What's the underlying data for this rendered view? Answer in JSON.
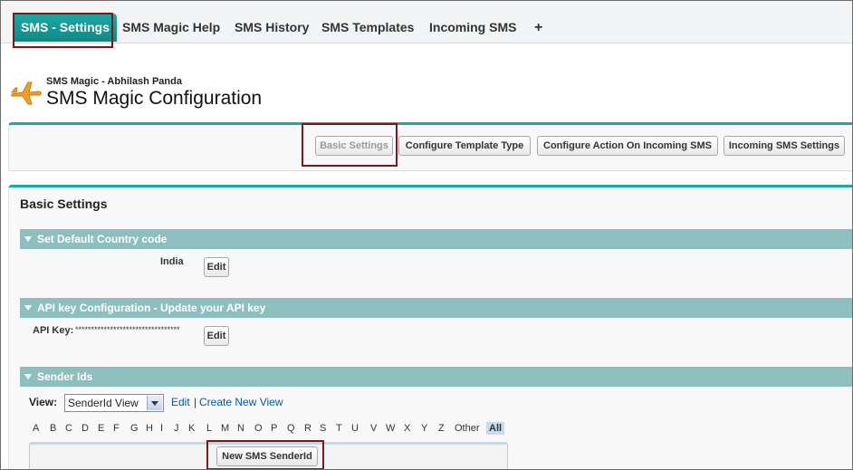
{
  "tabs": [
    {
      "label": "SMS - Settings",
      "active": true
    },
    {
      "label": "SMS Magic Help"
    },
    {
      "label": "SMS History"
    },
    {
      "label": "SMS Templates"
    },
    {
      "label": "Incoming SMS"
    },
    {
      "label": "+"
    }
  ],
  "header": {
    "subtitle": "SMS Magic - Abhilash Panda",
    "title": "SMS Magic Configuration",
    "icon": "airplane-icon"
  },
  "config_buttons": [
    {
      "label": "Basic Settings",
      "disabled": true
    },
    {
      "label": "Configure Template Type"
    },
    {
      "label": "Configure Action On Incoming SMS"
    },
    {
      "label": "Incoming SMS Settings"
    }
  ],
  "panel": {
    "title": "Basic Settings"
  },
  "sections": {
    "country": {
      "title": "Set Default Country code",
      "value": "India",
      "edit_label": "Edit"
    },
    "api": {
      "title": "API key Configuration - Update your API key",
      "label": "API Key:",
      "value": "*********************************",
      "edit_label": "Edit"
    },
    "sender": {
      "title": "Sender Ids",
      "view_label": "View:",
      "view_selected": "SenderId View",
      "edit_link": "Edit",
      "separator": "|",
      "create_link": "Create New View",
      "alphabet": [
        "A",
        "B",
        "C",
        "D",
        "E",
        "F",
        "G",
        "H",
        "I",
        "J",
        "K",
        "L",
        "M",
        "N",
        "O",
        "P",
        "Q",
        "R",
        "S",
        "T",
        "U",
        "V",
        "W",
        "X",
        "Y",
        "Z",
        "Other",
        "All"
      ],
      "new_button": "New SMS SenderId"
    }
  },
  "colors": {
    "accent": "#1ba9a4",
    "section_bar": "#8dbfbf",
    "highlight_box": "#7a1a1a",
    "link": "#015ba7"
  }
}
